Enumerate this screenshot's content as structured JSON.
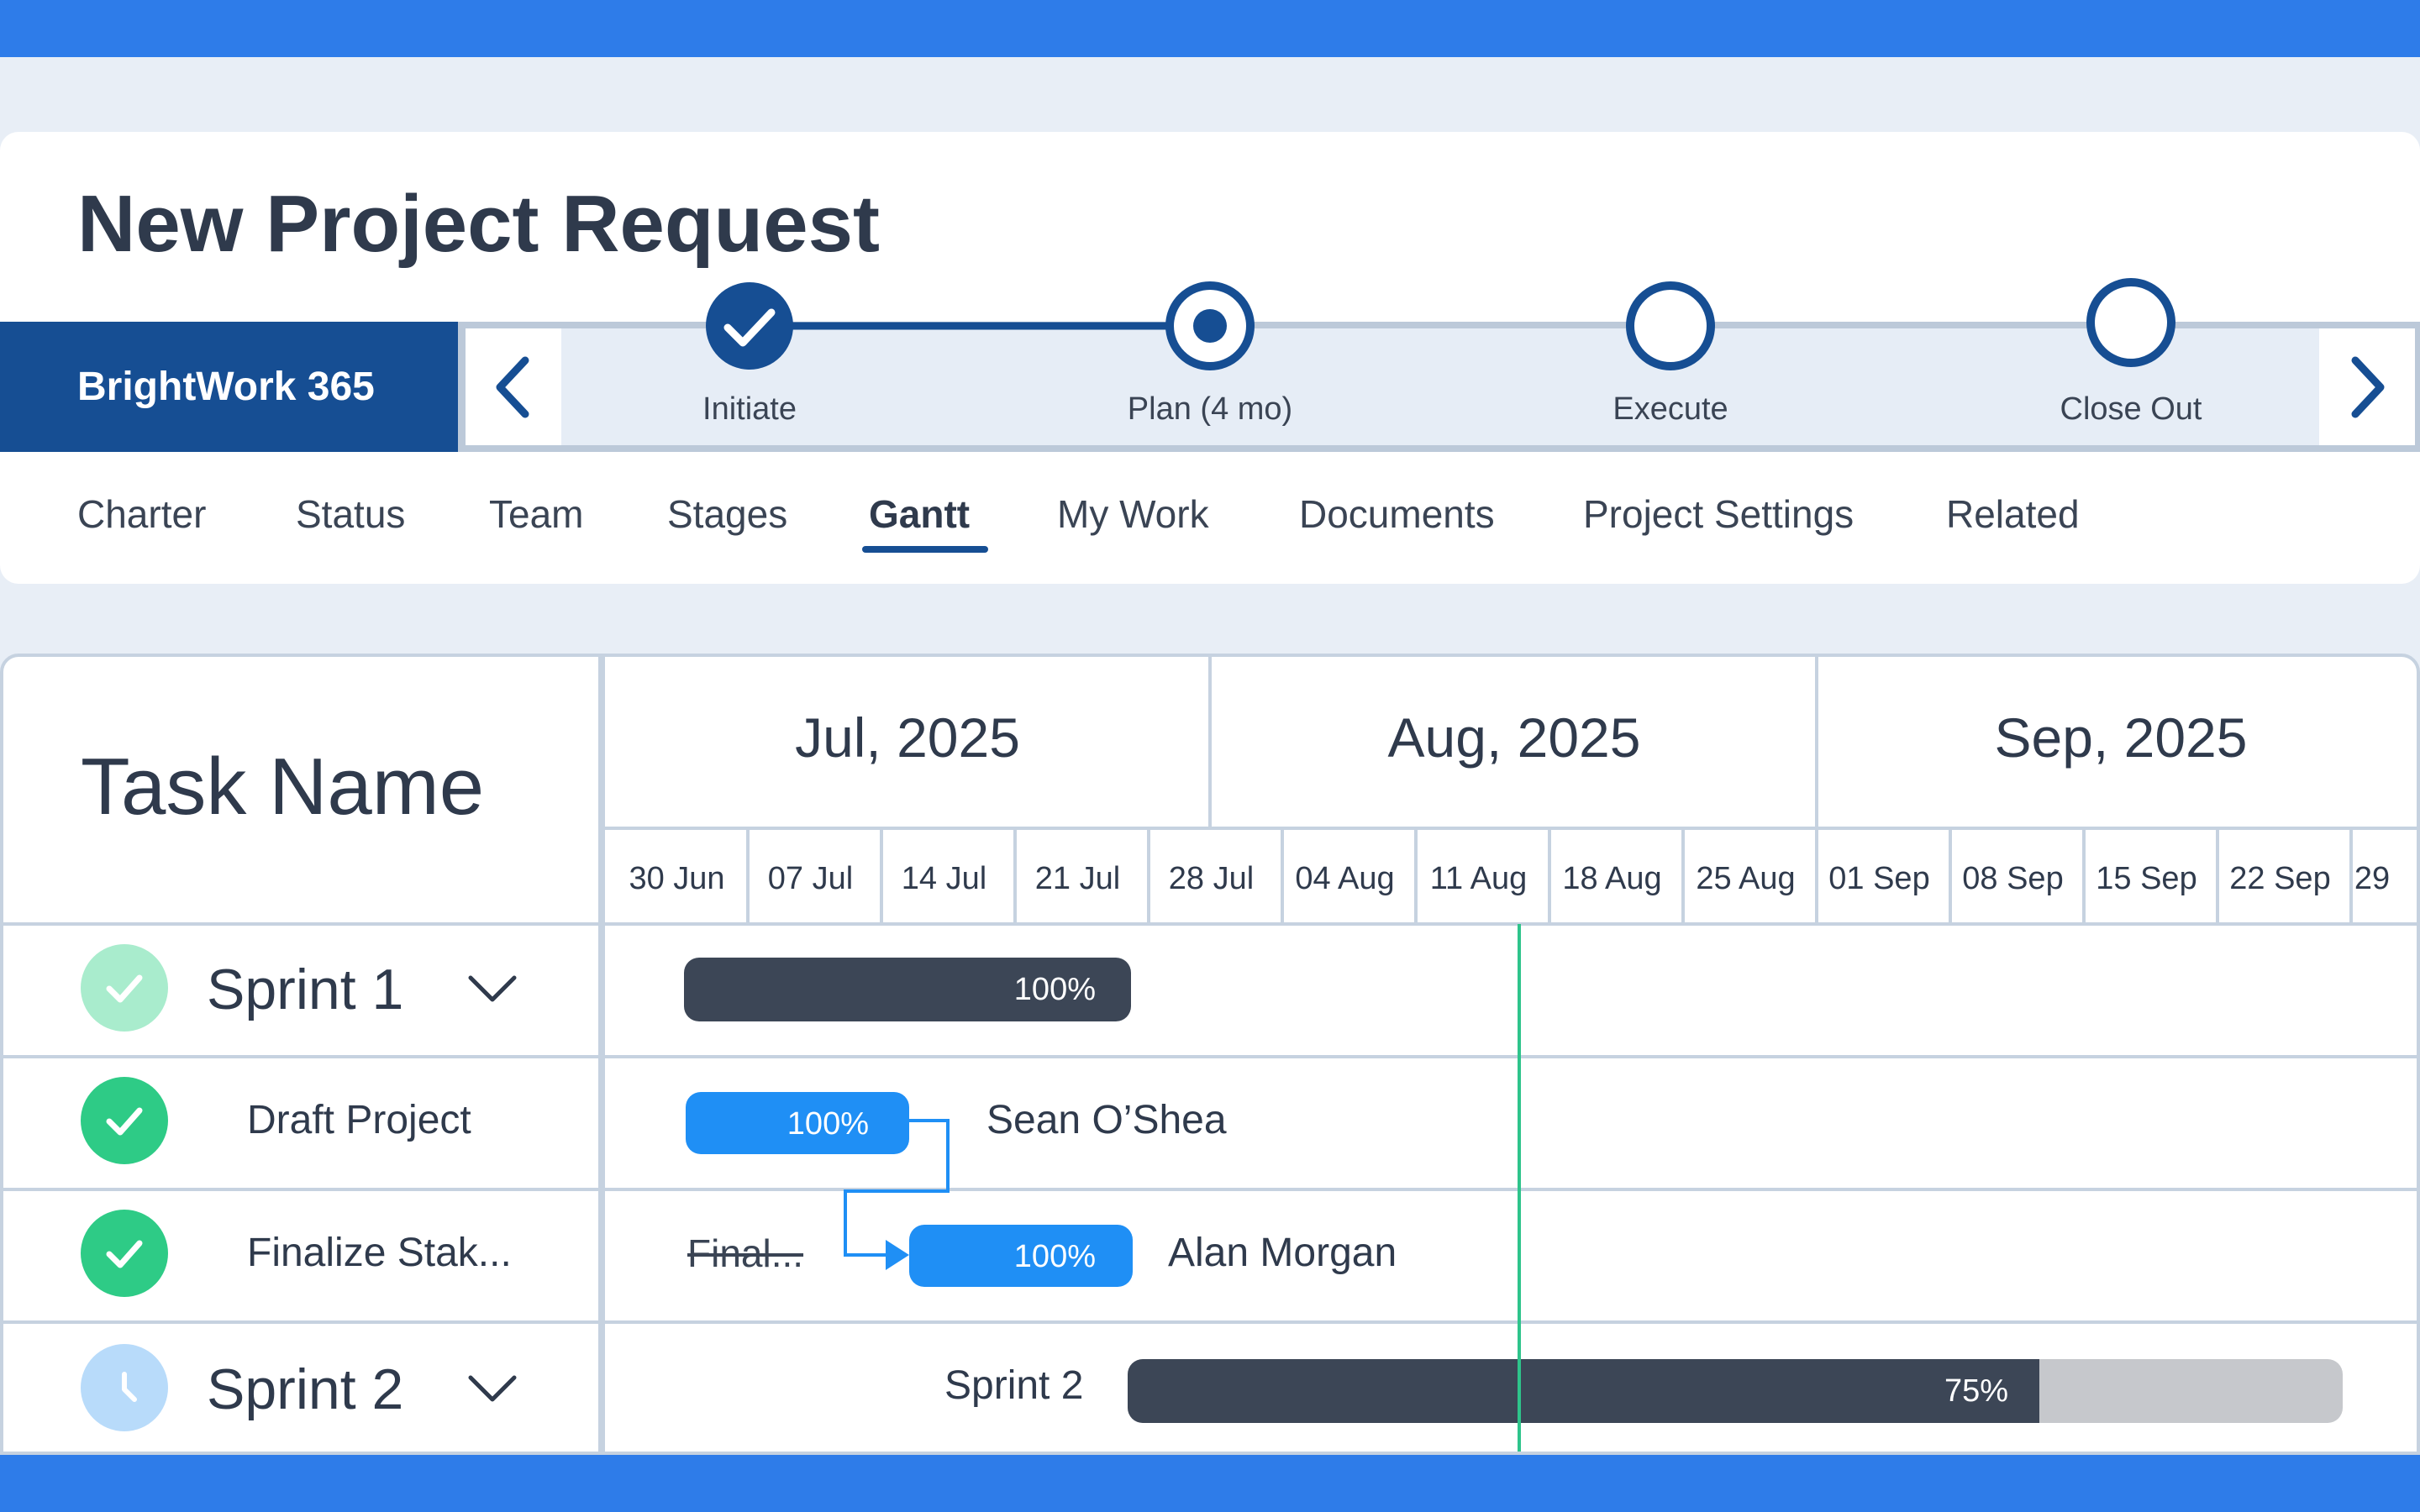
{
  "header": {
    "title": "New Project Request",
    "brand": "BrightWork 365"
  },
  "stages": [
    {
      "label": "Initiate",
      "state": "complete"
    },
    {
      "label": "Plan (4 mo)",
      "state": "current"
    },
    {
      "label": "Execute",
      "state": "pending"
    },
    {
      "label": "Close Out",
      "state": "pending"
    }
  ],
  "tabs": [
    {
      "label": "Charter",
      "active": false
    },
    {
      "label": "Status",
      "active": false
    },
    {
      "label": "Team",
      "active": false
    },
    {
      "label": "Stages",
      "active": false
    },
    {
      "label": "Gantt",
      "active": true
    },
    {
      "label": "My Work",
      "active": false
    },
    {
      "label": "Documents",
      "active": false
    },
    {
      "label": "Project Settings",
      "active": false
    },
    {
      "label": "Related",
      "active": false
    }
  ],
  "gantt": {
    "task_header": "Task Name",
    "months": [
      "Jul, 2025",
      "Aug, 2025",
      "Sep, 2025"
    ],
    "weeks": [
      "30 Jun",
      "07 Jul",
      "14 Jul",
      "21 Jul",
      "28 Jul",
      "04 Aug",
      "11 Aug",
      "18 Aug",
      "25 Aug",
      "01 Sep",
      "08 Sep",
      "15 Sep",
      "22 Sep",
      "29"
    ],
    "rows": [
      {
        "name": "Sprint 1",
        "type": "summary",
        "status": "complete",
        "progress_label": "100%",
        "progress": 1.0
      },
      {
        "name": "Draft Project",
        "type": "task",
        "status": "complete",
        "progress_label": "100%",
        "progress": 1.0,
        "assignee": "Sean O’Shea"
      },
      {
        "name": "Finalize Stak...",
        "type": "task",
        "status": "complete",
        "progress_label": "100%",
        "progress": 1.0,
        "assignee": "Alan Morgan",
        "baseline_label": "Final..."
      },
      {
        "name": "Sprint 2",
        "type": "summary",
        "status": "in-progress",
        "progress_label": "75%",
        "progress": 0.75,
        "bar_caption": "Sprint 2"
      }
    ]
  },
  "colors": {
    "top_bar": "#2e7ce9",
    "brand_bg": "#164e93",
    "task_bar": "#1f8ff5",
    "summary_bar": "#3c4656",
    "remaining": "#c6c8cc",
    "today_line": "#2ec48b",
    "complete_icon": "#2ecb86",
    "complete_icon_light": "#a9eccd",
    "inprogress_icon": "#b8dbfa"
  },
  "icons": {
    "prev": "chevron-left-icon",
    "next": "chevron-right-icon",
    "check": "check-icon",
    "expand": "chevron-down-icon",
    "clock": "clock-icon"
  }
}
